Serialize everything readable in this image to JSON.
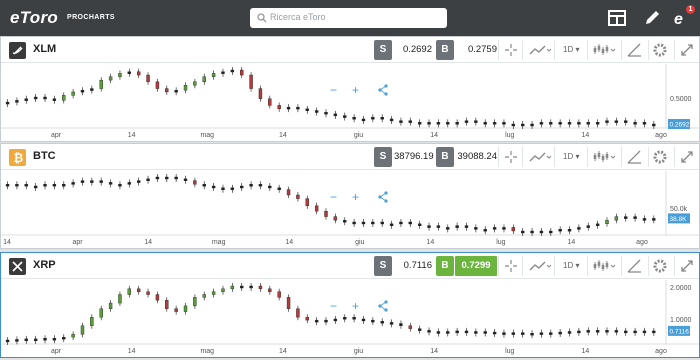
{
  "header": {
    "logo": "eToro",
    "logo_sub": "PROCHARTS",
    "search_placeholder": "Ricerca eToro",
    "notif_count": "1"
  },
  "colors": {
    "topbar": "#3c4043",
    "buy_active": "#6bb53f",
    "sell": "#6d7278",
    "up": "#5a9e3a",
    "down": "#b23b3b",
    "price_tag": "#4a9fd8"
  },
  "panels": [
    {
      "name": "XLM",
      "sell_label": "S",
      "buy_label": "B",
      "sell": "0.2692",
      "buy": "0.2759",
      "timeframe": "1D",
      "y_label": "0.5000",
      "last": "0.2692",
      "xticks": [
        "apr",
        "14",
        "mag",
        "14",
        "giu",
        "14",
        "lug",
        "14",
        "ago"
      ],
      "active": false,
      "chart_data": {
        "type": "candlestick",
        "series": [
          0.4,
          0.41,
          0.42,
          0.43,
          0.42,
          0.41,
          0.44,
          0.46,
          0.47,
          0.48,
          0.53,
          0.55,
          0.57,
          0.58,
          0.56,
          0.52,
          0.48,
          0.46,
          0.47,
          0.5,
          0.52,
          0.55,
          0.57,
          0.58,
          0.59,
          0.56,
          0.48,
          0.42,
          0.38,
          0.36,
          0.37,
          0.36,
          0.35,
          0.34,
          0.33,
          0.32,
          0.31,
          0.3,
          0.3,
          0.31,
          0.3,
          0.29,
          0.29,
          0.28,
          0.28,
          0.28,
          0.28,
          0.28,
          0.28,
          0.29,
          0.28,
          0.28,
          0.28,
          0.27,
          0.27,
          0.27,
          0.27,
          0.28,
          0.28,
          0.28,
          0.28,
          0.28,
          0.28,
          0.28,
          0.29,
          0.29,
          0.28,
          0.28,
          0.27,
          0.27
        ]
      }
    },
    {
      "name": "BTC",
      "sell_label": "S",
      "buy_label": "B",
      "sell": "38796.19",
      "buy": "39088.24",
      "timeframe": "1D",
      "y_label": "50.0k",
      "last": "38.8K",
      "xticks": [
        "14",
        "apr",
        "14",
        "mag",
        "14",
        "giu",
        "14",
        "lug",
        "14",
        "ago"
      ],
      "active": false,
      "chart_data": {
        "type": "candlestick",
        "series": [
          58,
          58,
          57,
          57,
          58,
          57,
          58,
          59,
          60,
          60,
          59,
          58,
          58,
          59,
          60,
          61,
          62,
          62,
          61,
          60,
          58,
          57,
          56,
          55,
          56,
          57,
          58,
          57,
          56,
          55,
          52,
          50,
          46,
          43,
          40,
          38,
          37,
          36,
          37,
          37,
          36,
          36,
          37,
          36,
          35,
          35,
          34,
          34,
          35,
          34,
          33,
          33,
          34,
          34,
          32,
          32,
          32,
          32,
          32,
          33,
          33,
          34,
          35,
          36,
          38,
          40,
          40,
          39,
          39,
          39
        ]
      }
    },
    {
      "name": "XRP",
      "sell_label": "S",
      "buy_label": "B",
      "sell": "0.7116",
      "buy": "0.7299",
      "timeframe": "1D",
      "y_label": "2.0000",
      "y_label2": "1.0000",
      "last": "0.7116",
      "xticks": [
        "apr",
        "14",
        "mag",
        "14",
        "giu",
        "14",
        "lug",
        "14",
        "ago"
      ],
      "active": true,
      "chart_data": {
        "type": "candlestick",
        "series": [
          0.55,
          0.56,
          0.57,
          0.57,
          0.58,
          0.58,
          0.6,
          0.65,
          0.8,
          0.95,
          1.1,
          1.2,
          1.35,
          1.45,
          1.4,
          1.35,
          1.25,
          1.1,
          1.05,
          1.15,
          1.3,
          1.35,
          1.4,
          1.45,
          1.5,
          1.48,
          1.5,
          1.45,
          1.4,
          1.3,
          1.1,
          0.95,
          0.9,
          0.88,
          0.9,
          0.92,
          0.95,
          0.92,
          0.9,
          0.88,
          0.86,
          0.84,
          0.8,
          0.75,
          0.72,
          0.7,
          0.7,
          0.7,
          0.71,
          0.7,
          0.7,
          0.69,
          0.68,
          0.68,
          0.68,
          0.67,
          0.67,
          0.68,
          0.68,
          0.69,
          0.7,
          0.71,
          0.72,
          0.72,
          0.72,
          0.71,
          0.71,
          0.71,
          0.71,
          0.71
        ]
      }
    }
  ]
}
